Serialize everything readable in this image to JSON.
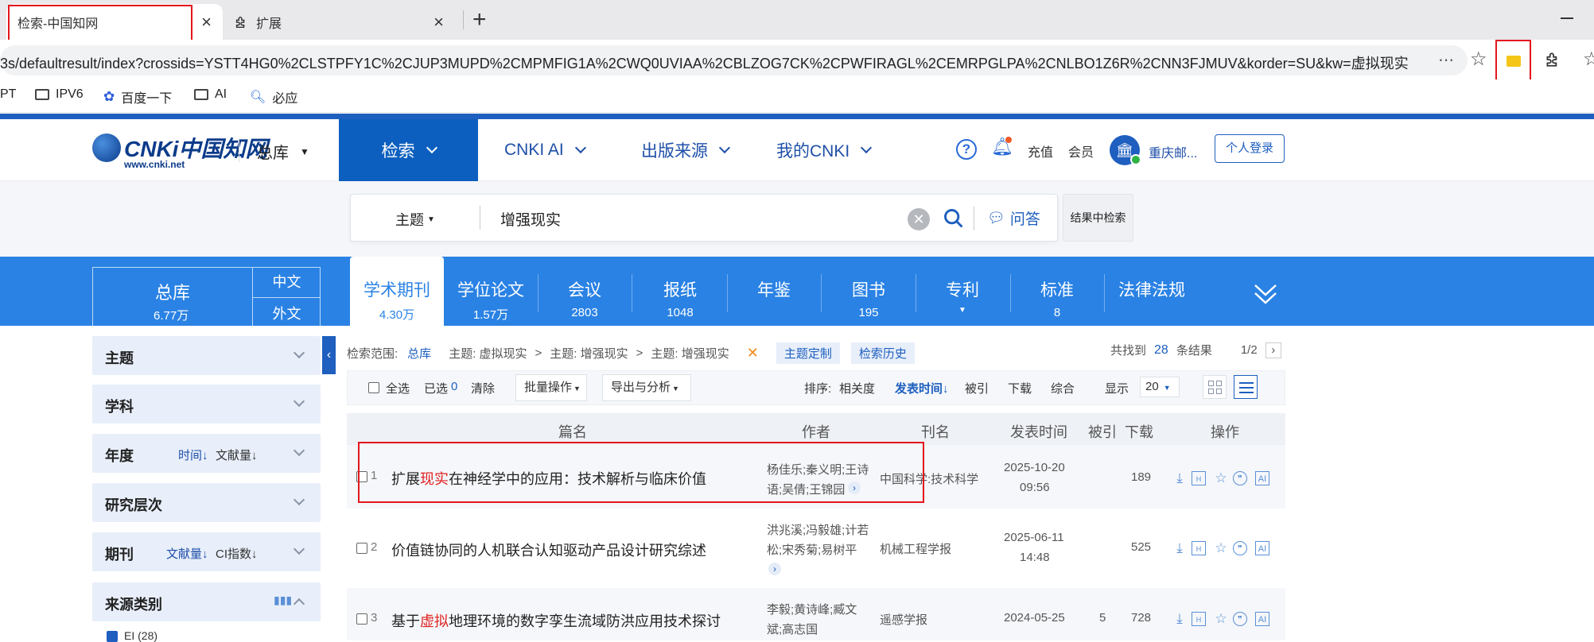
{
  "browser": {
    "tabs": [
      {
        "label": "检索-中国知网"
      },
      {
        "label": "扩展"
      }
    ],
    "url": "3s/defaultresult/index?crossids=YSTT4HG0%2CLSTPFY1C%2CJUP3MUPD%2CMPMFIG1A%2CWQ0UVIAA%2CBLZOG7CK%2CPWFIRAGL%2CEMRPGLPA%2CNLBO1Z6R%2CNN3FJMUV&korder=SU&kw=虚拟现实",
    "bookmarks": [
      "PT",
      "IPV6",
      "百度一下",
      "AI",
      "必应"
    ]
  },
  "header": {
    "logo_text": "CNKi中国知网",
    "logo_sub": "www.cnki.net",
    "library": "总库",
    "nav": [
      "检索",
      "CNKI AI",
      "出版来源",
      "我的CNKI"
    ],
    "recharge": "充值",
    "member": "会员",
    "institution": "重庆邮...",
    "login": "个人登录"
  },
  "search": {
    "field": "主题",
    "query": "增强现实",
    "qa_label": "问答",
    "in_result_label": "结果中检索"
  },
  "categories": {
    "total_label": "总库",
    "total_count": "6.77万",
    "lang_cn": "中文",
    "lang_en": "外文",
    "items": [
      {
        "name": "学术期刊",
        "count": "4.30万"
      },
      {
        "name": "学位论文",
        "count": "1.57万"
      },
      {
        "name": "会议",
        "count": "2803"
      },
      {
        "name": "报纸",
        "count": "1048"
      },
      {
        "name": "年鉴",
        "count": ""
      },
      {
        "name": "图书",
        "count": "195"
      },
      {
        "name": "专利",
        "count": ""
      },
      {
        "name": "标准",
        "count": "8"
      },
      {
        "name": "法律法规",
        "count": ""
      }
    ]
  },
  "sidebar": {
    "facets": [
      {
        "title": "主题"
      },
      {
        "title": "学科"
      },
      {
        "title": "年度",
        "sort1": "时间",
        "sort2": "文献量"
      },
      {
        "title": "研究层次"
      },
      {
        "title": "期刊",
        "sort1": "文献量",
        "sort2": "CI指数"
      },
      {
        "title": "来源类别"
      }
    ],
    "ei_label": "EI (28)"
  },
  "results": {
    "scope_label": "检索范围:",
    "scope_value": "总库",
    "crumb1": "主题: 虚拟现实",
    "crumb2": "主题: 增强现实",
    "crumb3": "主题: 增强现实",
    "topic_custom": "主题定制",
    "search_history": "检索历史",
    "found_prefix": "共找到",
    "found_count": "28",
    "found_suffix": "条结果",
    "pager": "1/2",
    "toolbar": {
      "select_all": "全选",
      "selected_label": "已选",
      "selected_count": "0",
      "clear": "清除",
      "batch": "批量操作",
      "export": "导出与分析",
      "sort_label": "排序:",
      "sort_relevance": "相关度",
      "sort_date": "发表时间",
      "sort_cited": "被引",
      "sort_download": "下载",
      "sort_overall": "综合",
      "display_label": "显示",
      "display_value": "20"
    },
    "columns": [
      "篇名",
      "作者",
      "刊名",
      "发表时间",
      "被引",
      "下载",
      "操作"
    ],
    "rows": [
      {
        "num": "1",
        "pre": "扩展",
        "hl": "现实",
        "post": "在神经学中的应用：技术解析与临床价值",
        "author1": "杨佳乐;秦义明;王诗",
        "author2": "语;吴倩;王锦园",
        "journal": "中国科学:技术科学",
        "date1": "2025-10-20",
        "date2": "09:56",
        "cited": "",
        "downloads": "189"
      },
      {
        "num": "2",
        "pre": "价值链协同的人机联合认知驱动产品设计研究综述",
        "hl": "",
        "post": "",
        "author1": "洪兆溪;冯毅雄;计若",
        "author2": "松;宋秀菊;易树平",
        "journal": "机械工程学报",
        "date1": "2025-06-11",
        "date2": "14:48",
        "cited": "",
        "downloads": "525"
      },
      {
        "num": "3",
        "pre": "基于",
        "hl": "虚拟",
        "post": "地理环境的数字孪生流域防洪应用技术探讨",
        "author1": "李毅;黄诗峰;臧文",
        "author2": "斌;高志国",
        "journal": "遥感学报",
        "date1": "2024-05-25",
        "date2": "",
        "cited": "5",
        "downloads": "728"
      }
    ]
  },
  "colors": {
    "brand_blue": "#0d5fbf",
    "band_blue": "#2a82e4",
    "highlight_red": "#e02020"
  }
}
